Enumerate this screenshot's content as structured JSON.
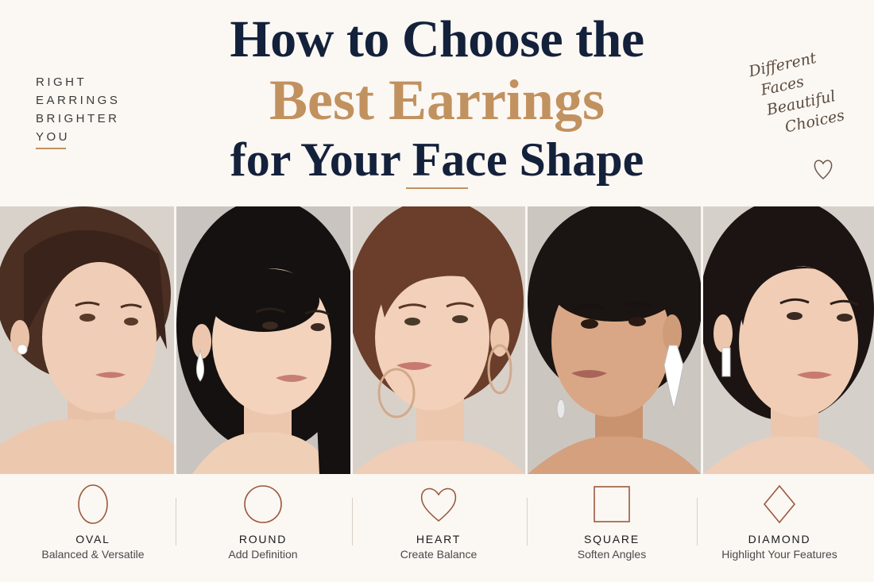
{
  "title": {
    "line1": "How to Choose the",
    "line2": "Best Earrings",
    "line3": "for Your Face Shape"
  },
  "tagline": [
    "RIGHT",
    "EARRINGS",
    "BRIGHTER",
    "YOU"
  ],
  "script_note": [
    "Different",
    "Faces",
    "Beautiful",
    "Choices"
  ],
  "colors": {
    "navy": "#14213b",
    "gold": "#c1915f",
    "icon_brown": "#9a5a3e",
    "background": "#faf6f2"
  },
  "photos": [
    {
      "face_shape": "oval",
      "earring": "stud"
    },
    {
      "face_shape": "round",
      "earring": "teardrop"
    },
    {
      "face_shape": "heart",
      "earring": "hoop"
    },
    {
      "face_shape": "square",
      "earring": "chandelier"
    },
    {
      "face_shape": "diamond",
      "earring": "rectangular drop"
    }
  ],
  "face_shapes": [
    {
      "name": "OVAL",
      "description": "Balanced & Versatile",
      "icon": "oval-icon"
    },
    {
      "name": "ROUND",
      "description": "Add Definition",
      "icon": "circle-icon"
    },
    {
      "name": "HEART",
      "description": "Create Balance",
      "icon": "heart-icon"
    },
    {
      "name": "SQUARE",
      "description": "Soften Angles",
      "icon": "square-icon"
    },
    {
      "name": "DIAMOND",
      "description": "Highlight Your Features",
      "icon": "diamond-icon"
    }
  ]
}
